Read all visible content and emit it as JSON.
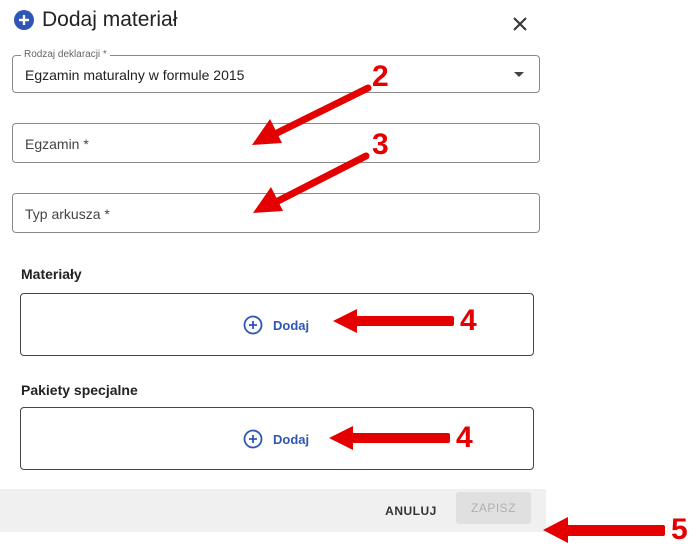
{
  "dialog": {
    "title": "Dodaj materiał",
    "icon": "plus-circle-icon",
    "close_icon": "close-icon"
  },
  "form": {
    "declaration_type": {
      "legend": "Rodzaj deklaracji *",
      "value": "Egzamin maturalny w formule 2015"
    },
    "exam": {
      "placeholder": "Egzamin *"
    },
    "sheet_type": {
      "placeholder": "Typ arkusza *"
    }
  },
  "materials": {
    "label": "Materiały",
    "add_label": "Dodaj"
  },
  "special_packages": {
    "label": "Pakiety specjalne",
    "add_label": "Dodaj"
  },
  "footer": {
    "cancel_label": "ANULUJ",
    "save_label": "ZAPISZ"
  },
  "annotations": {
    "exam_marker": "2",
    "sheet_marker": "3",
    "materials_marker": "4",
    "packages_marker": "4",
    "save_marker": "5"
  },
  "colors": {
    "accent": "#2f56b6",
    "annotation": "#e40000"
  }
}
